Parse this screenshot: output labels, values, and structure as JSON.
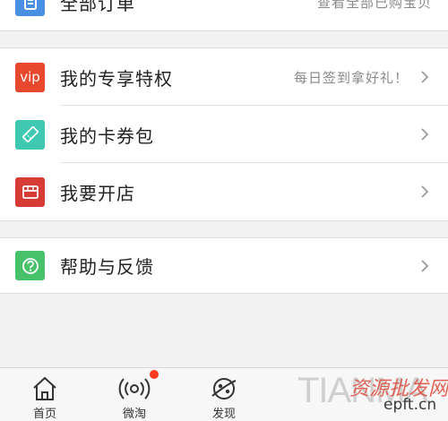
{
  "orders": {
    "label": "全部订单",
    "hint": "查看全部已购宝贝"
  },
  "menu_group_1": [
    {
      "label": "我的专享特权",
      "hint": "每日签到拿好礼！",
      "icon_text": "vip",
      "icon": "vip-icon",
      "color": "#e8482e"
    },
    {
      "label": "我的卡券包",
      "hint": "",
      "icon": "ticket-icon",
      "color": "#3fc9b3"
    },
    {
      "label": "我要开店",
      "hint": "",
      "icon": "store-icon",
      "color": "#d63b35"
    }
  ],
  "menu_group_2": [
    {
      "label": "帮助与反馈",
      "hint": "",
      "icon": "help-icon",
      "color": "#47c26a"
    }
  ],
  "tabbar": {
    "tabs": [
      {
        "label": "首页",
        "icon": "home-icon"
      },
      {
        "label": "微淘",
        "icon": "broadcast-icon",
        "badge": true
      },
      {
        "label": "发现",
        "icon": "discover-icon"
      }
    ]
  },
  "watermark": {
    "text_left": "TIANMA",
    "text_cn": "资源批发网",
    "text_url": "epft.cn"
  },
  "colors": {
    "accent_red": "#ff3b1f",
    "orders_icon": "#4a90e2"
  }
}
